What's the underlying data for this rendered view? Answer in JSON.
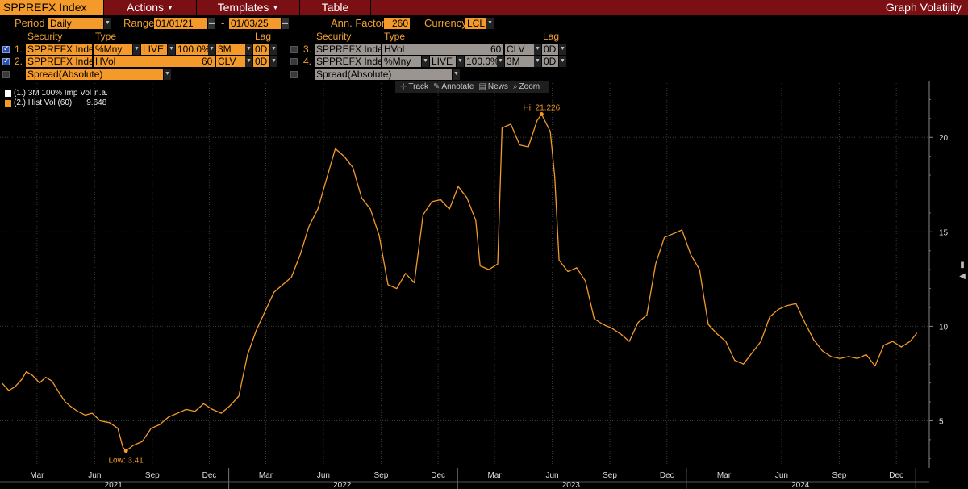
{
  "menu": {
    "security": "SPPREFX Index",
    "actions": "Actions",
    "templates": "Templates",
    "table": "Table",
    "right_title": "Graph Volatility"
  },
  "controls": {
    "period_label": "Period",
    "period_value": "Daily",
    "range_label": "Range",
    "range_start": "01/01/21",
    "range_sep": "-",
    "range_end": "01/03/25",
    "ann_factor_label": "Ann. Factor",
    "ann_factor_value": "260",
    "currency_label": "Currency",
    "currency_value": "LCL"
  },
  "table_headers": {
    "security": "Security",
    "type": "Type",
    "lag": "Lag"
  },
  "rows_left": [
    {
      "num": "1.",
      "security": "SPPREFX Inde:",
      "type": "%Mny",
      "live": "LIVE",
      "mny": "100.0%",
      "tenor": "3M",
      "lag": "0D"
    },
    {
      "num": "2.",
      "security": "SPPREFX Inde:",
      "type": "HVol",
      "window": "60",
      "clv": "CLV",
      "lag": "0D"
    },
    {
      "spread": "Spread(Absolute)"
    }
  ],
  "rows_right": [
    {
      "num": "3.",
      "security": "SPPREFX Inde:",
      "type": "HVol",
      "window": "60",
      "clv": "CLV",
      "lag": "0D"
    },
    {
      "num": "4.",
      "security": "SPPREFX Inde:",
      "type": "%Mny",
      "live": "LIVE",
      "mny": "100.0%",
      "tenor": "3M",
      "lag": "0D"
    },
    {
      "spread": "Spread(Absolute)"
    }
  ],
  "tools": {
    "track": "Track",
    "annotate": "Annotate",
    "news": "News",
    "zoom": "Zoom"
  },
  "legend": [
    {
      "label": "(1.) 3M 100% Imp Vol",
      "value": "n.a.",
      "color": "#ffffff"
    },
    {
      "label": "(2.) Hist Vol (60)",
      "value": "9.648",
      "color": "#f39a2a"
    }
  ],
  "chart_data": {
    "type": "line",
    "series": [
      {
        "name": "(2.) Hist Vol (60)",
        "color": "#f39a2a",
        "points": [
          [
            "2021-01-04",
            7.0
          ],
          [
            "2021-01-15",
            6.6
          ],
          [
            "2021-01-25",
            6.8
          ],
          [
            "2021-02-05",
            7.2
          ],
          [
            "2021-02-12",
            7.6
          ],
          [
            "2021-02-22",
            7.4
          ],
          [
            "2021-03-05",
            7.0
          ],
          [
            "2021-03-15",
            7.3
          ],
          [
            "2021-03-25",
            7.1
          ],
          [
            "2021-04-05",
            6.5
          ],
          [
            "2021-04-15",
            6.0
          ],
          [
            "2021-04-26",
            5.7
          ],
          [
            "2021-05-05",
            5.5
          ],
          [
            "2021-05-17",
            5.3
          ],
          [
            "2021-05-28",
            5.4
          ],
          [
            "2021-06-10",
            5.0
          ],
          [
            "2021-06-25",
            4.9
          ],
          [
            "2021-07-08",
            4.6
          ],
          [
            "2021-07-16",
            3.6
          ],
          [
            "2021-07-21",
            3.41
          ],
          [
            "2021-08-02",
            3.7
          ],
          [
            "2021-08-16",
            3.9
          ],
          [
            "2021-08-30",
            4.6
          ],
          [
            "2021-09-13",
            4.8
          ],
          [
            "2021-09-27",
            5.2
          ],
          [
            "2021-10-11",
            5.4
          ],
          [
            "2021-10-25",
            5.6
          ],
          [
            "2021-11-08",
            5.5
          ],
          [
            "2021-11-22",
            5.9
          ],
          [
            "2021-12-06",
            5.6
          ],
          [
            "2021-12-20",
            5.4
          ],
          [
            "2022-01-03",
            5.8
          ],
          [
            "2022-01-17",
            6.3
          ],
          [
            "2022-01-31",
            8.5
          ],
          [
            "2022-02-14",
            9.8
          ],
          [
            "2022-02-28",
            10.8
          ],
          [
            "2022-03-14",
            11.8
          ],
          [
            "2022-03-28",
            12.2
          ],
          [
            "2022-04-11",
            12.6
          ],
          [
            "2022-04-25",
            13.8
          ],
          [
            "2022-05-09",
            15.3
          ],
          [
            "2022-05-23",
            16.2
          ],
          [
            "2022-06-06",
            17.8
          ],
          [
            "2022-06-20",
            19.4
          ],
          [
            "2022-07-04",
            19.0
          ],
          [
            "2022-07-18",
            18.4
          ],
          [
            "2022-08-01",
            16.8
          ],
          [
            "2022-08-15",
            16.2
          ],
          [
            "2022-08-29",
            14.8
          ],
          [
            "2022-09-12",
            12.2
          ],
          [
            "2022-09-26",
            12.0
          ],
          [
            "2022-10-10",
            12.8
          ],
          [
            "2022-10-24",
            12.3
          ],
          [
            "2022-11-07",
            15.9
          ],
          [
            "2022-11-21",
            16.6
          ],
          [
            "2022-12-05",
            16.7
          ],
          [
            "2022-12-19",
            16.2
          ],
          [
            "2023-01-02",
            17.4
          ],
          [
            "2023-01-16",
            16.8
          ],
          [
            "2023-01-30",
            15.6
          ],
          [
            "2023-02-06",
            13.2
          ],
          [
            "2023-02-20",
            13.0
          ],
          [
            "2023-03-06",
            13.3
          ],
          [
            "2023-03-13",
            20.5
          ],
          [
            "2023-03-27",
            20.7
          ],
          [
            "2023-04-10",
            19.6
          ],
          [
            "2023-04-24",
            19.5
          ],
          [
            "2023-05-08",
            20.9
          ],
          [
            "2023-05-15",
            21.226
          ],
          [
            "2023-05-29",
            20.3
          ],
          [
            "2023-06-05",
            17.9
          ],
          [
            "2023-06-12",
            13.5
          ],
          [
            "2023-06-26",
            12.9
          ],
          [
            "2023-07-10",
            13.1
          ],
          [
            "2023-07-24",
            12.4
          ],
          [
            "2023-08-07",
            10.4
          ],
          [
            "2023-08-21",
            10.1
          ],
          [
            "2023-09-04",
            9.9
          ],
          [
            "2023-09-18",
            9.6
          ],
          [
            "2023-10-02",
            9.2
          ],
          [
            "2023-10-16",
            10.2
          ],
          [
            "2023-10-30",
            10.6
          ],
          [
            "2023-11-13",
            13.3
          ],
          [
            "2023-11-27",
            14.7
          ],
          [
            "2023-12-11",
            14.9
          ],
          [
            "2023-12-25",
            15.1
          ],
          [
            "2024-01-08",
            13.8
          ],
          [
            "2024-01-22",
            13.0
          ],
          [
            "2024-02-05",
            10.1
          ],
          [
            "2024-02-19",
            9.6
          ],
          [
            "2024-03-04",
            9.2
          ],
          [
            "2024-03-18",
            8.2
          ],
          [
            "2024-04-01",
            8.0
          ],
          [
            "2024-04-15",
            8.6
          ],
          [
            "2024-04-29",
            9.2
          ],
          [
            "2024-05-13",
            10.5
          ],
          [
            "2024-05-27",
            10.9
          ],
          [
            "2024-06-10",
            11.1
          ],
          [
            "2024-06-24",
            11.2
          ],
          [
            "2024-07-08",
            10.2
          ],
          [
            "2024-07-22",
            9.3
          ],
          [
            "2024-08-05",
            8.7
          ],
          [
            "2024-08-19",
            8.4
          ],
          [
            "2024-09-02",
            8.3
          ],
          [
            "2024-09-16",
            8.4
          ],
          [
            "2024-09-30",
            8.3
          ],
          [
            "2024-10-14",
            8.5
          ],
          [
            "2024-10-28",
            7.9
          ],
          [
            "2024-11-11",
            9.0
          ],
          [
            "2024-11-25",
            9.2
          ],
          [
            "2024-12-09",
            8.9
          ],
          [
            "2024-12-23",
            9.2
          ],
          [
            "2025-01-03",
            9.648
          ]
        ]
      }
    ],
    "annotations": [
      {
        "text": "Hi: 21.226",
        "date": "2023-05-15",
        "value": 21.226
      },
      {
        "text": "Low: 3.41",
        "date": "2021-07-21",
        "value": 3.41
      }
    ],
    "ylim": [
      2.5,
      23
    ],
    "yticks": [
      5,
      10,
      15,
      20
    ],
    "xlim": [
      "2021-01-01",
      "2025-01-20"
    ],
    "month_ticks": [
      {
        "date": "2021-03-01",
        "label": "Mar"
      },
      {
        "date": "2021-06-01",
        "label": "Jun"
      },
      {
        "date": "2021-09-01",
        "label": "Sep"
      },
      {
        "date": "2021-12-01",
        "label": "Dec"
      },
      {
        "date": "2022-03-01",
        "label": "Mar"
      },
      {
        "date": "2022-06-01",
        "label": "Jun"
      },
      {
        "date": "2022-09-01",
        "label": "Sep"
      },
      {
        "date": "2022-12-01",
        "label": "Dec"
      },
      {
        "date": "2023-03-01",
        "label": "Mar"
      },
      {
        "date": "2023-06-01",
        "label": "Jun"
      },
      {
        "date": "2023-09-01",
        "label": "Sep"
      },
      {
        "date": "2023-12-01",
        "label": "Dec"
      },
      {
        "date": "2024-03-01",
        "label": "Mar"
      },
      {
        "date": "2024-06-01",
        "label": "Jun"
      },
      {
        "date": "2024-09-01",
        "label": "Sep"
      },
      {
        "date": "2024-12-01",
        "label": "Dec"
      }
    ],
    "year_labels": [
      {
        "date": "2021-07-01",
        "label": "2021"
      },
      {
        "date": "2022-07-01",
        "label": "2022"
      },
      {
        "date": "2023-07-01",
        "label": "2023"
      },
      {
        "date": "2024-07-01",
        "label": "2024"
      }
    ],
    "year_boundaries": [
      "2022-01-01",
      "2023-01-01",
      "2024-01-01",
      "2025-01-01"
    ],
    "grid": true
  }
}
